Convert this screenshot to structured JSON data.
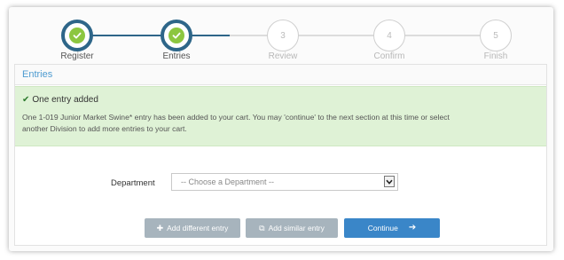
{
  "stepper": {
    "steps": [
      {
        "label": "Register",
        "status": "done"
      },
      {
        "label": "Entries",
        "status": "done"
      },
      {
        "label": "Review",
        "status": "todo",
        "number": "3"
      },
      {
        "label": "Confirm",
        "status": "todo",
        "number": "4"
      },
      {
        "label": "Finish",
        "status": "todo",
        "number": "5"
      }
    ],
    "colors": {
      "done_ring": "#2e6689",
      "check": "#8cc63f",
      "line_done": "#2e6689",
      "line_todo": "#dcdcdc"
    }
  },
  "panel": {
    "title": "Entries"
  },
  "alert": {
    "title": "One entry added",
    "message_line1": "One 1-019 Junior Market Swine* entry has been added to your cart. You may 'continue' to the next section at this time or select",
    "message_line2": "another Division to add more entries to your cart.",
    "background": "#dff2d6"
  },
  "department": {
    "label": "Department",
    "placeholder": "-- Choose a Department --"
  },
  "buttons": {
    "add_different": "Add different entry",
    "add_similar": "Add similar entry",
    "continue": "Continue"
  }
}
